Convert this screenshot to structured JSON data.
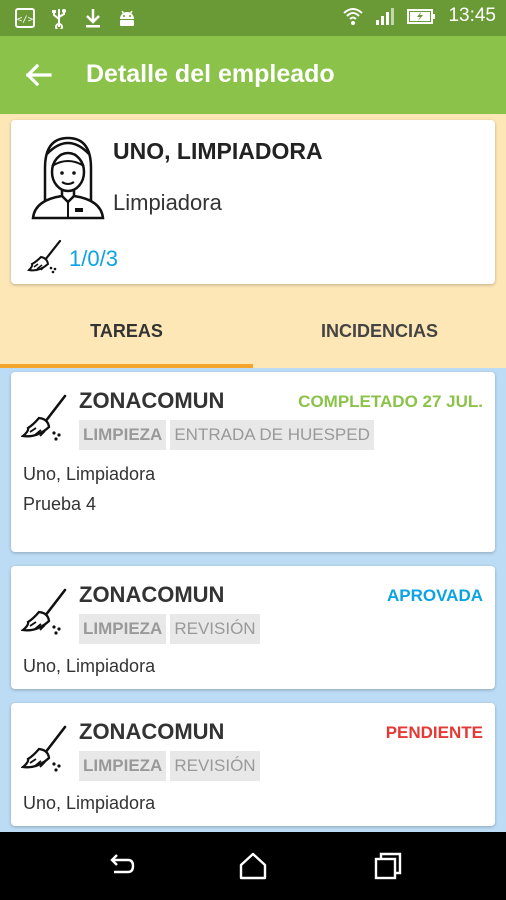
{
  "status_bar": {
    "time": "13:45",
    "left_icons": [
      "code-icon",
      "usb-icon",
      "download-icon",
      "android-icon"
    ],
    "right_icons": [
      "wifi-icon",
      "signal-icon",
      "battery-icon"
    ]
  },
  "app_bar": {
    "title": "Detalle del empleado",
    "back_icon": "arrow-back-icon"
  },
  "employee": {
    "name": "UNO, LIMPIADORA",
    "role": "Limpiadora",
    "counts": "1/0/3",
    "avatar_icon": "maid-avatar-icon",
    "counts_icon": "broom-icon"
  },
  "tabs": [
    {
      "label": "TAREAS",
      "selected": true
    },
    {
      "label": "INCIDENCIAS",
      "selected": false
    }
  ],
  "accent_colors": {
    "app_bar": "#8bc34a",
    "status_bar": "#6a9a36",
    "header_bg": "#fde7b6",
    "tab_indicator": "#f4a62a",
    "list_bg": "#bcdcf5",
    "counts": "#0ba3e3"
  },
  "tasks": [
    {
      "zone": "ZONACOMUN",
      "status": "COMPLETADO 27 JUL.",
      "status_color": "#8bc34a",
      "tags": [
        "LIMPIEZA",
        "ENTRADA DE HUESPED"
      ],
      "lines": [
        "Uno, Limpiadora",
        "Prueba 4"
      ]
    },
    {
      "zone": "ZONACOMUN",
      "status": "APROVADA",
      "status_color": "#0ba3e3",
      "tags": [
        "LIMPIEZA",
        "REVISIÓN"
      ],
      "lines": [
        "Uno, Limpiadora"
      ]
    },
    {
      "zone": "ZONACOMUN",
      "status": "PENDIENTE",
      "status_color": "#e53935",
      "tags": [
        "LIMPIEZA",
        "REVISIÓN"
      ],
      "lines": [
        "Uno, Limpiadora"
      ]
    }
  ],
  "nav_bar": {
    "icons": [
      "back-nav-icon",
      "home-nav-icon",
      "recents-nav-icon"
    ]
  }
}
